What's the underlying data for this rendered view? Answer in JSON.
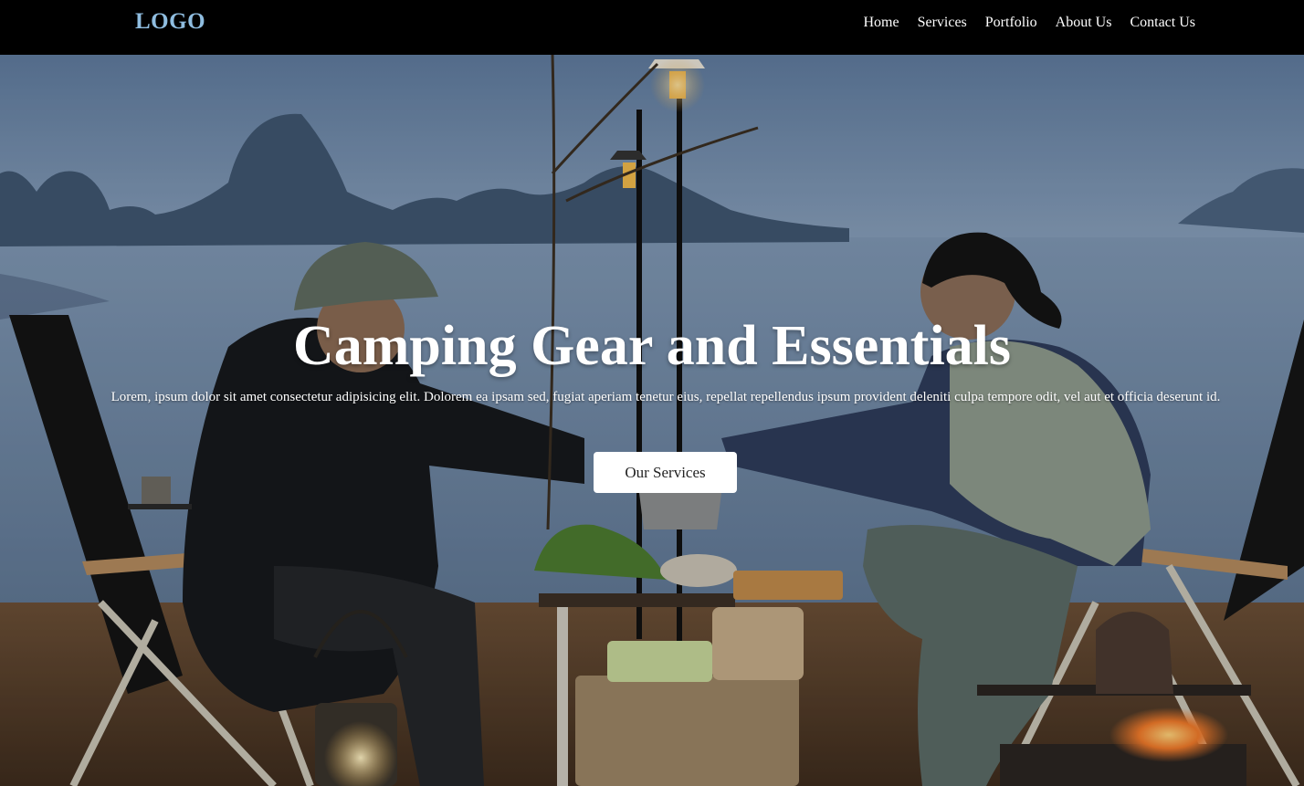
{
  "nav": {
    "logo": "LOGO",
    "links": [
      "Home",
      "Services",
      "Portfolio",
      "About Us",
      "Contact Us"
    ]
  },
  "hero": {
    "title": "Camping Gear and Essentials",
    "text": "Lorem, ipsum dolor sit amet consectetur adipisicing elit. Dolorem ea ipsam sed, fugiat aperiam tenetur eius, repellat repellendus ipsum provident deleniti culpa tempore odit, vel aut et officia deserunt id.",
    "button_label": "Our Services"
  },
  "colors": {
    "navbar_bg": "#000000",
    "logo": "#8fbde0",
    "nav_text": "#ffffff",
    "button_bg": "#ffffff"
  }
}
